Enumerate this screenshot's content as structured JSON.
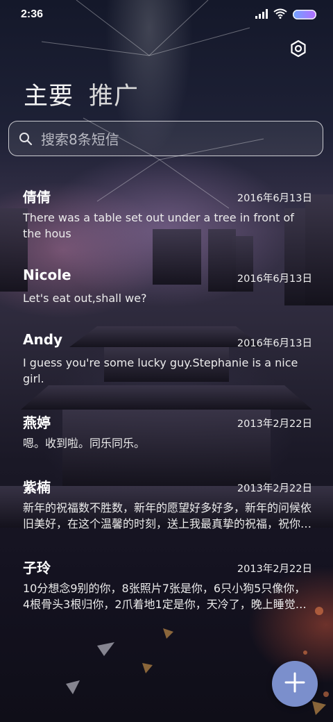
{
  "status_bar": {
    "time": "2:36",
    "icons": [
      "signal-icon",
      "wifi-icon",
      "battery-icon"
    ],
    "battery_colors": [
      "#6fa5ff",
      "#b46bff"
    ]
  },
  "header": {
    "tabs": [
      {
        "label": "主要",
        "active": true
      },
      {
        "label": "推广",
        "active": false
      }
    ],
    "settings_icon": "gear-icon"
  },
  "search": {
    "placeholder": "搜索8条短信",
    "value": ""
  },
  "messages": [
    {
      "name": "倩倩",
      "date": "2016年6月13日",
      "preview": "There was a table set out under a tree in front of the hous"
    },
    {
      "name": "Nicole",
      "date": "2016年6月13日",
      "preview": "Let's eat out,shall we?"
    },
    {
      "name": "Andy",
      "date": "2016年6月13日",
      "preview": "I guess you're some lucky guy.Stephanie is a nice girl."
    },
    {
      "name": "燕婷",
      "date": "2013年2月22日",
      "preview": "嗯。收到啦。同乐同乐。"
    },
    {
      "name": "紫楠",
      "date": "2013年2月22日",
      "preview": "新年的祝福数不胜数，新年的愿望好多好多，新年的问候依旧美好，在这个温馨的时刻，送上我最真挚的祝福，祝你新年快乐！"
    },
    {
      "name": "子玲",
      "date": "2013年2月22日",
      "preview": "10分想念9别的你，8张照片7张是你，6只小狗5只像你，4根骨头3根归你，2爪着地1定是你，天冷了，晚上睡觉盖好被子！"
    }
  ],
  "fab": {
    "icon": "plus-icon",
    "color": "#7b8fcc"
  }
}
